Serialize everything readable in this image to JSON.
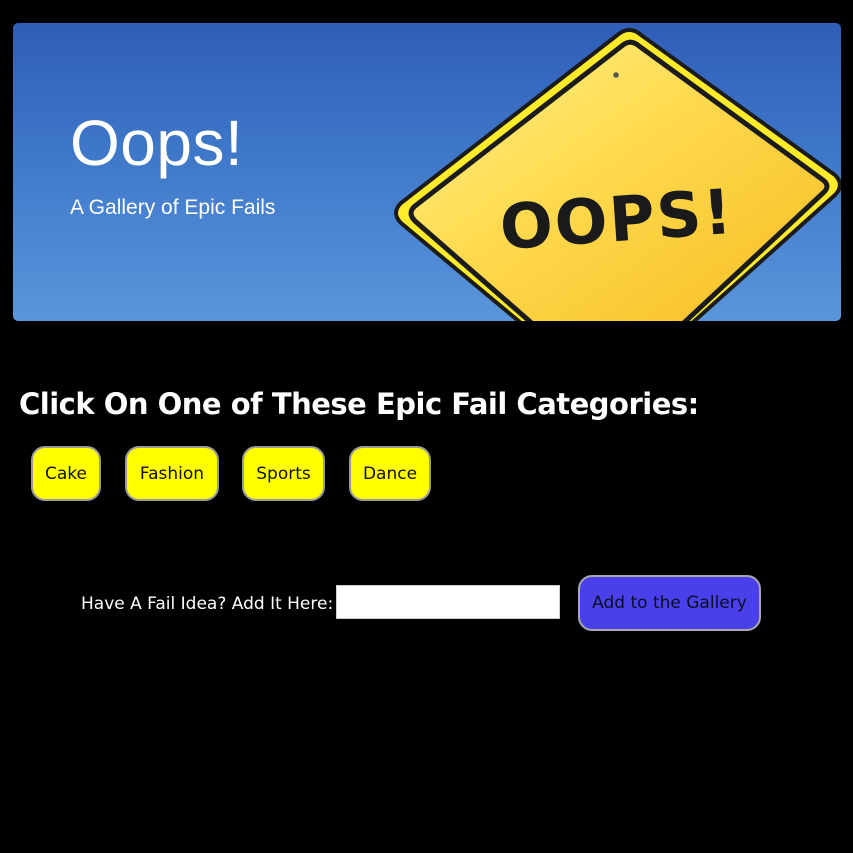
{
  "hero": {
    "title": "Oops!",
    "subtitle": "A Gallery of Epic Fails",
    "sign_text": "OOPS!"
  },
  "categories": {
    "heading": "Click On One of These Epic Fail Categories:",
    "items": [
      {
        "label": "Cake"
      },
      {
        "label": "Fashion"
      },
      {
        "label": "Sports"
      },
      {
        "label": "Dance"
      }
    ]
  },
  "add_idea": {
    "label": "Have A Fail Idea? Add It Here:",
    "input_value": "",
    "input_placeholder": "",
    "button_label": "Add to the Gallery"
  },
  "colors": {
    "page_background": "#000000",
    "category_button": "#ffff00",
    "add_button": "#4a40ea",
    "sign_yellow": "#ffd84a",
    "sky_blue": "#3f78c9"
  }
}
